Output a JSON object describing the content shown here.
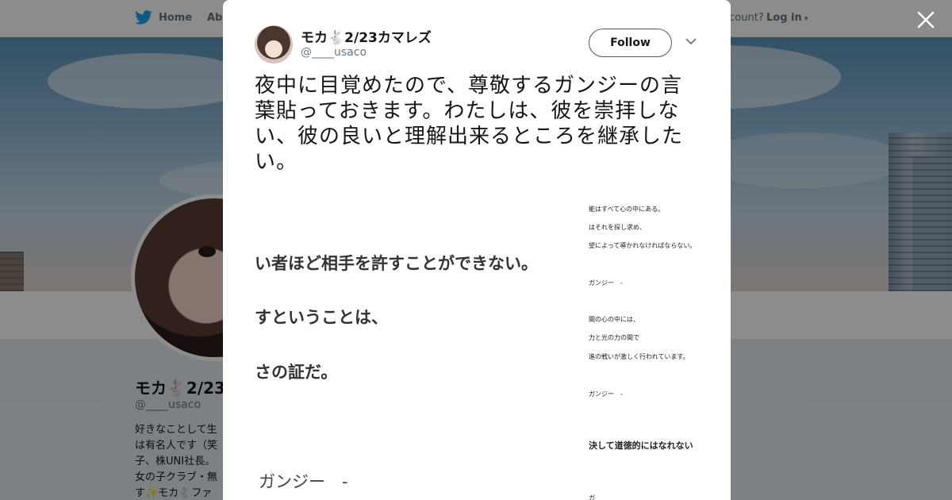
{
  "nav": {
    "home": "Home",
    "about": "Abo",
    "account": "ccount?",
    "login": "Log in"
  },
  "profile": {
    "name": "モカ🐇2/23",
    "handle": "@____usaco",
    "bio": "好きなことして生\nは有名人です（笑\n子、株UNI社長。\n女の子クラブ・無\nす✨モカ🐇ファ"
  },
  "tweet": {
    "name": "モカ🐇2/23カマレズ",
    "handle": "@____usaco",
    "follow_label": "Follow",
    "text": "夜中に目覚めたので、尊敬するガンジーの言葉貼っておきます。わたしは、彼を崇拝しない、彼の良いと理解出来るところを継承したい。"
  },
  "image_left": {
    "lines": [
      "い者ほど相手を許すことができない。",
      "すということは、",
      "さの証だ。"
    ],
    "author": "ガンジー　-"
  },
  "image_right": {
    "lines": [
      "能はすべて心の中にある。",
      "はそれを探し求め、",
      "望によって導かれなければならない。",
      "ガンジー　-",
      "間の心の中には、",
      "力と光の力の間で",
      "進の戦いが激しく行われています。",
      "ガンジー　-",
      "決して道徳的にはなれない",
      "ガ"
    ]
  },
  "colors": {
    "twitter_blue": "#1da1f2",
    "text": "#14171a",
    "secondary": "#657786"
  }
}
